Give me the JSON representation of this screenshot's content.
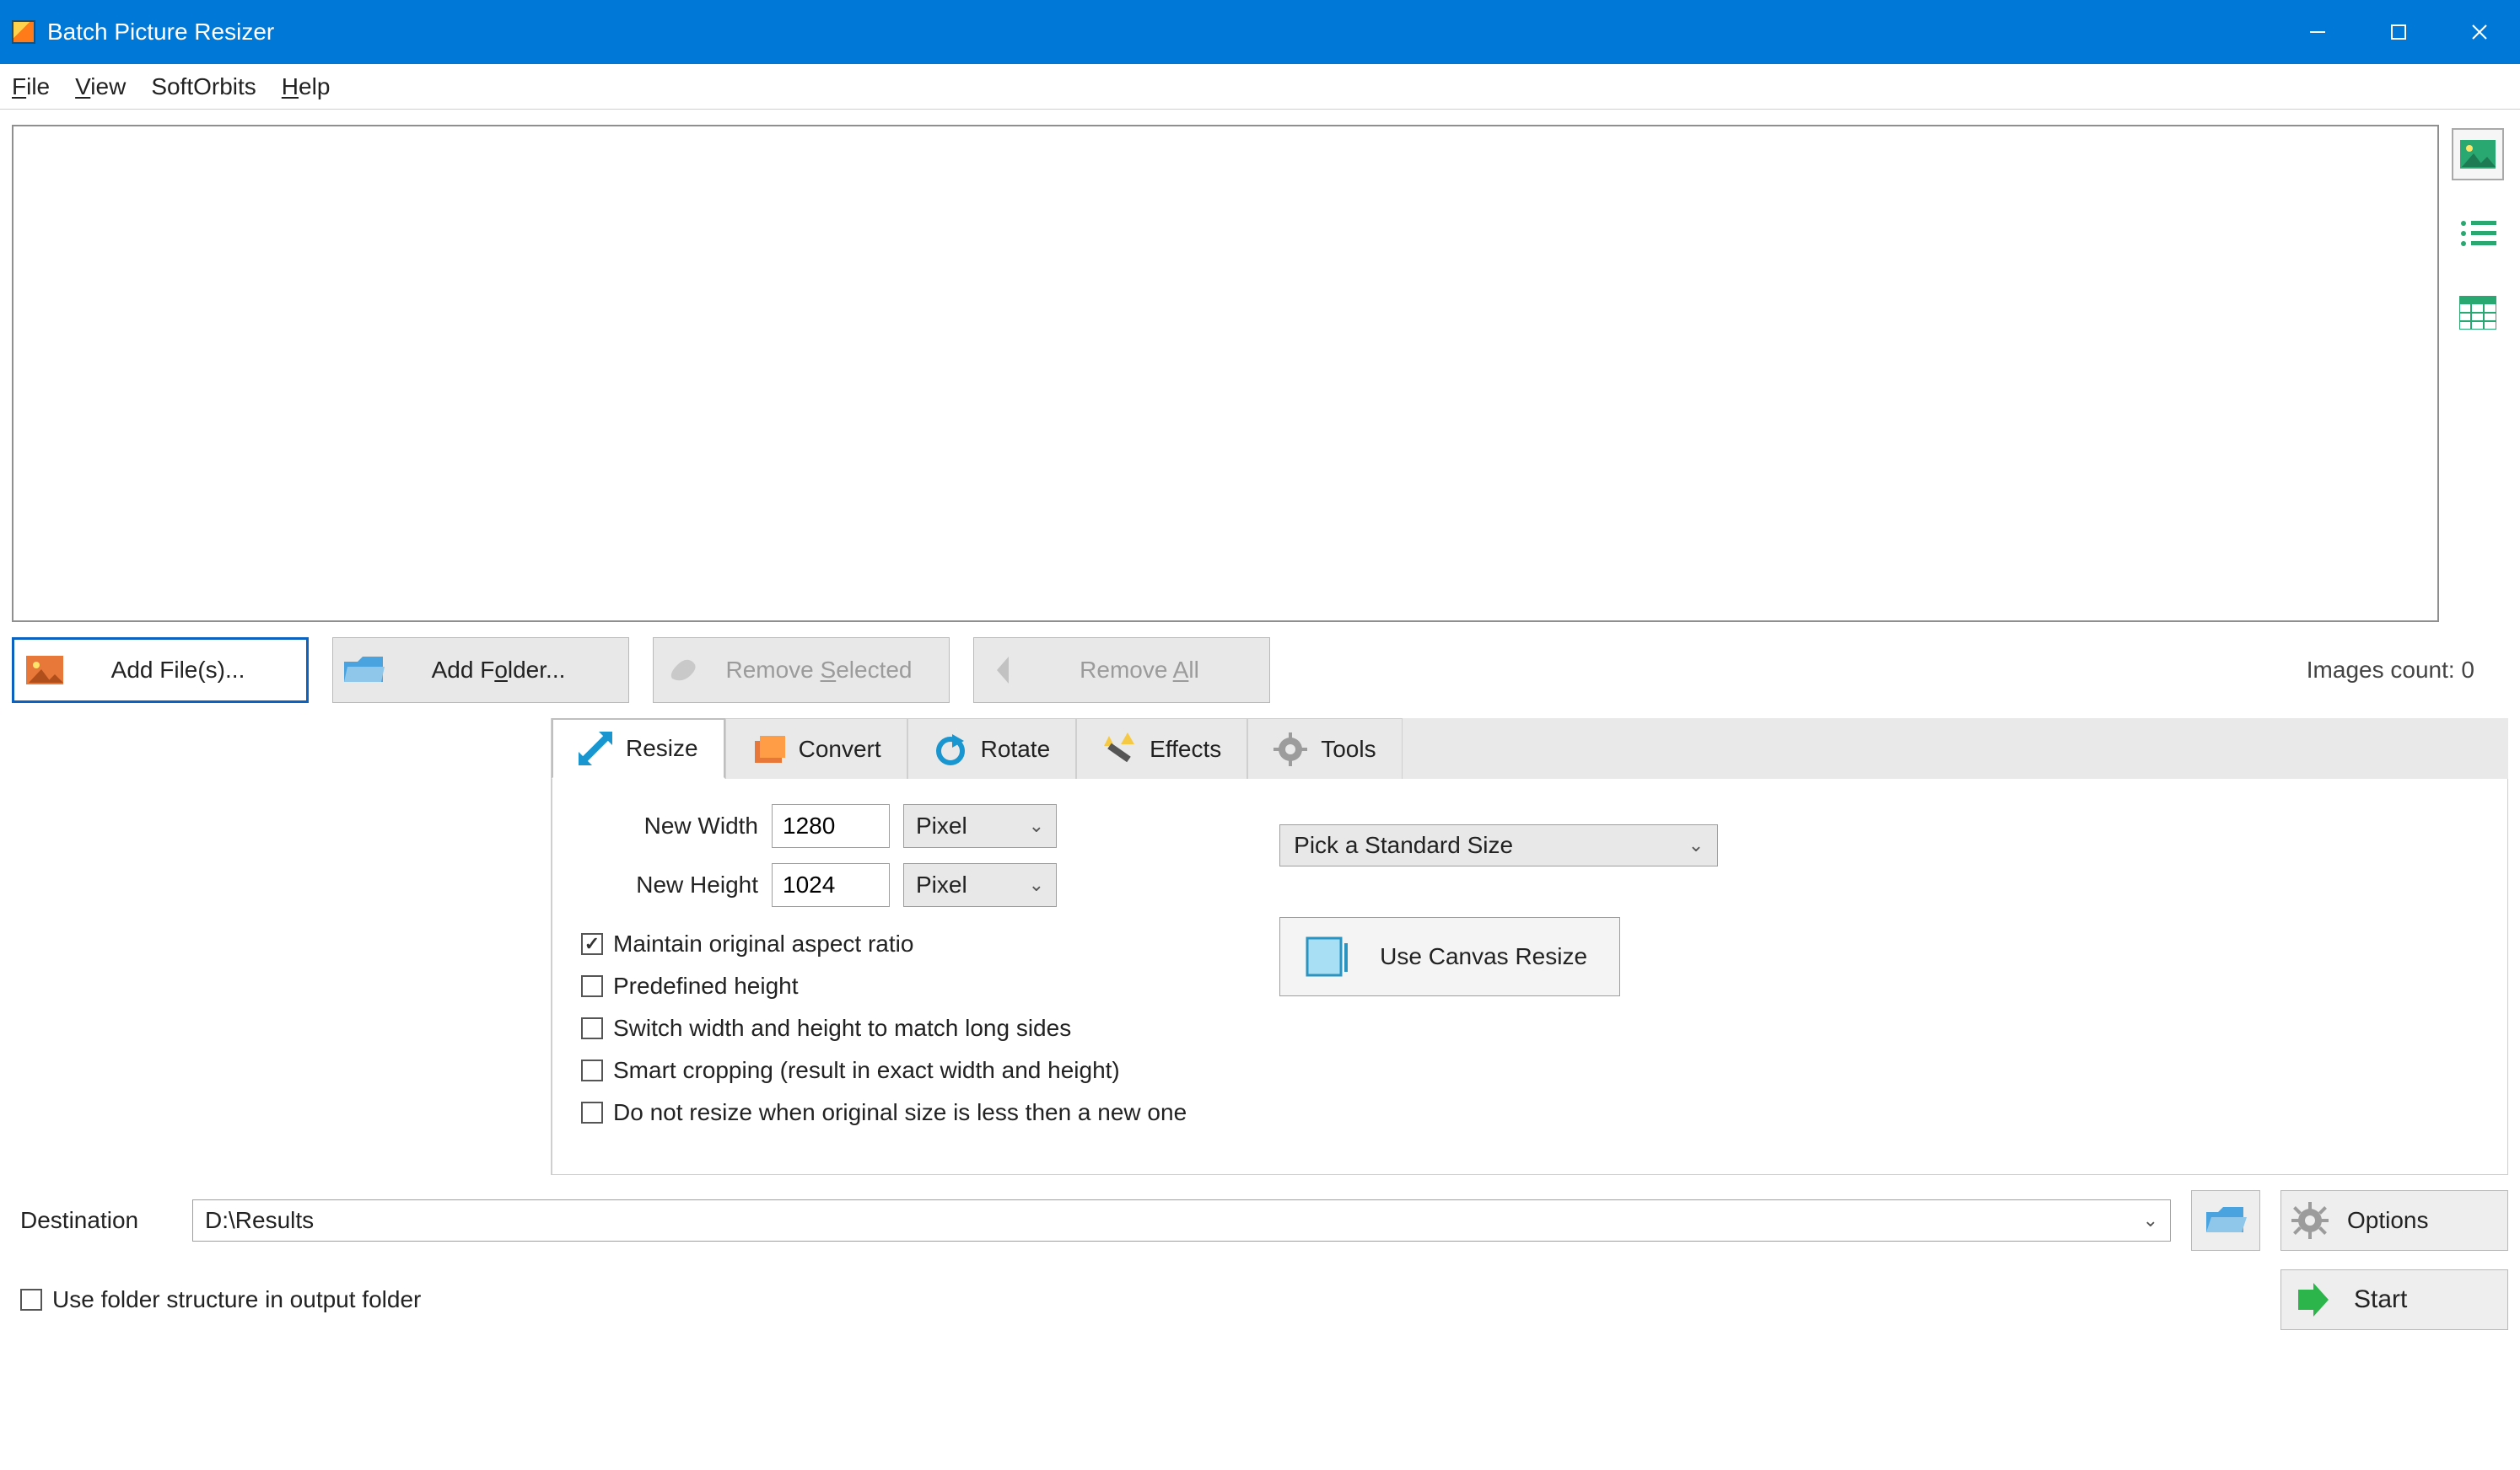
{
  "window": {
    "title": "Batch Picture Resizer"
  },
  "menu": {
    "file": "File",
    "view": "View",
    "softorbits": "SoftOrbits",
    "help": "Help"
  },
  "file_buttons": {
    "add_files": "Add File(s)...",
    "add_folder": "Add Folder...",
    "remove_selected": "Remove Selected",
    "remove_all": "Remove All",
    "count_label": "Images count: 0"
  },
  "tabs": {
    "resize": "Resize",
    "convert": "Convert",
    "rotate": "Rotate",
    "effects": "Effects",
    "tools": "Tools"
  },
  "resize_tab": {
    "new_width_label": "New Width",
    "new_width_value": "1280",
    "new_height_label": "New Height",
    "new_height_value": "1024",
    "unit_width": "Pixel",
    "unit_height": "Pixel",
    "maintain_ratio": "Maintain original aspect ratio",
    "predefined_height": "Predefined height",
    "switch_sides": "Switch width and height to match long sides",
    "smart_crop": "Smart cropping (result in exact width and height)",
    "no_upscale": "Do not resize when original size is less then a new one",
    "standard_placeholder": "Pick a Standard Size",
    "canvas_button": "Use Canvas Resize"
  },
  "bottom": {
    "destination_label": "Destination",
    "destination_value": "D:\\Results",
    "use_folder_structure": "Use folder structure in output folder",
    "options": "Options",
    "start": "Start"
  }
}
